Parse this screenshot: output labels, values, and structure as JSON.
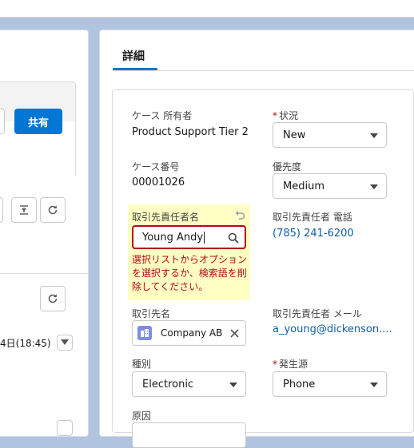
{
  "left": {
    "share_label": "共有",
    "date_partial": "4日(18:45)"
  },
  "tabs": {
    "detail": "詳細"
  },
  "fields": {
    "case_owner": {
      "label": "ケース 所有者",
      "value": "Product Support Tier 2"
    },
    "status": {
      "label": "状況",
      "value": "New"
    },
    "case_number": {
      "label": "ケース番号",
      "value": "00001026"
    },
    "priority": {
      "label": "優先度",
      "value": "Medium"
    },
    "contact_name": {
      "label": "取引先責任者名",
      "value": "Young Andy",
      "error": "選択リストからオプションを選択するか、検索語を削除してください。"
    },
    "contact_phone": {
      "label": "取引先責任者 電話",
      "value": "(785) 241-6200"
    },
    "account_name": {
      "label": "取引先名",
      "value": "Company AB"
    },
    "contact_email": {
      "label": "取引先責任者 メール",
      "value": "a_young@dickenson...."
    },
    "type": {
      "label": "種別",
      "value": "Electronic"
    },
    "origin": {
      "label": "発生源",
      "value": "Phone"
    },
    "reason": {
      "label": "原因"
    }
  },
  "colors": {
    "brand": "#0176d3",
    "error": "#ba0517",
    "edit_highlight": "#ffffc4",
    "link": "#0b5cab"
  }
}
